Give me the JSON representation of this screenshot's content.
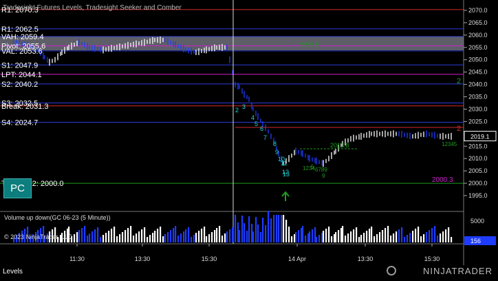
{
  "chart_title": "Tradesight Futures Levels, Tradesight Seeker and Comber",
  "price_axis_ticks": [
    "2070.0",
    "2065.0",
    "2060.0",
    "2055.0",
    "2050.0",
    "2045.0",
    "2040.0",
    "2035.0",
    "2030.0",
    "2025.0",
    "2020.0",
    "2015.0",
    "2010.0",
    "2005.0",
    "2000.0",
    "1995.0"
  ],
  "current_price": "2019.1",
  "volume_axis_ticks": [
    "5000",
    "0"
  ],
  "current_volume": "156",
  "volume_title": "Volume up down(GC 06-23 (5 Minute))",
  "copyright": "© 2023 NinjaTrader, LLC",
  "time_axis_ticks": [
    "11:30",
    "13:30",
    "15:30",
    "14 Apr",
    "13:30",
    "15:30"
  ],
  "levels": [
    {
      "label": "R1:",
      "value": "2070.3"
    },
    {
      "label": "R1:",
      "value": "2062.5"
    },
    {
      "label": "VAH:",
      "value": "2059.4"
    },
    {
      "label": "Pivot:",
      "value": "2055.6"
    },
    {
      "label": "VAL:",
      "value": "2053.6"
    },
    {
      "label": "S1:",
      "value": "2047.9"
    },
    {
      "label": "LPT:",
      "value": "2044.1"
    },
    {
      "label": "S2:",
      "value": "2040.2"
    },
    {
      "label": "S3:",
      "value": "2032.5"
    },
    {
      "label": "Break:",
      "value": "2031.3"
    },
    {
      "label": "S4:",
      "value": "2024.7"
    },
    {
      "label": "Tgt Stop 2:",
      "value": "2000.0"
    }
  ],
  "annotations": {
    "pink_price": "2000.3",
    "green_line_price": "2013.8",
    "green_right_label": "2",
    "red_right_label": "2",
    "upper_green_label": "2055.6"
  },
  "seq_numbers": [
    "2",
    "3",
    "4",
    "5",
    "6",
    "7",
    "8",
    "9",
    "10",
    "11",
    "12",
    "13"
  ],
  "green_seq": [
    "1234",
    "5",
    "6789",
    "9",
    "12345"
  ],
  "buttons": {
    "pc": "PC"
  },
  "bottom_tab": "Levels",
  "logo_text": "NINJATRADER",
  "colors": {
    "background": "#000000",
    "up_bar": "#ffffff",
    "down_bar": "#1e3cff",
    "level_blue": "#2a3cd8",
    "level_red": "#d62a2a",
    "value_area": "#6e6e7a",
    "cyan": "#20d8d8",
    "green": "#1e9d1e",
    "magenta": "#d020d0"
  }
}
